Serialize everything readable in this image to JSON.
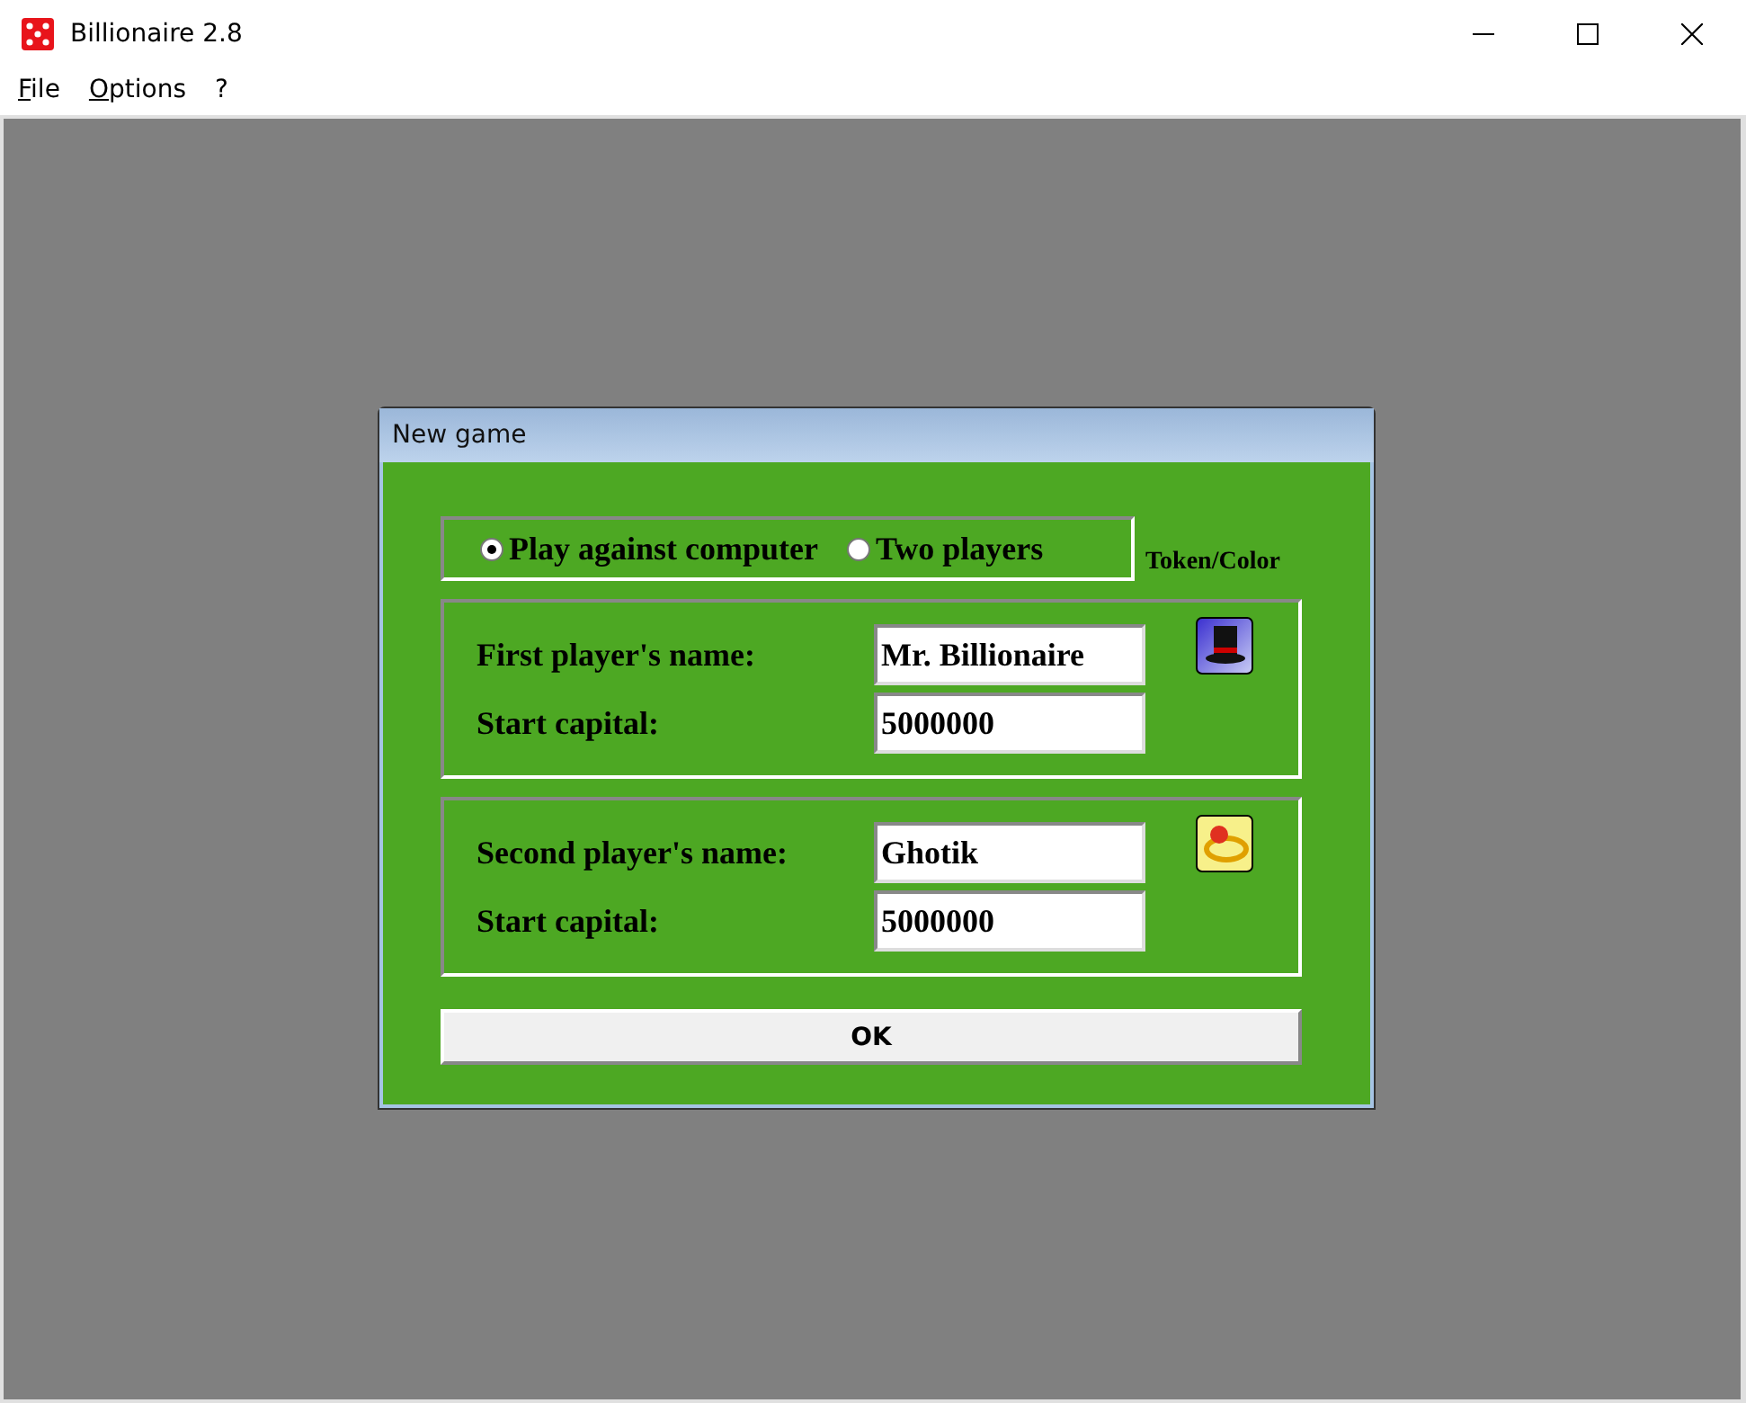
{
  "window": {
    "title": "Billionaire 2.8"
  },
  "menu": [
    {
      "label": "File"
    },
    {
      "label": "Options"
    },
    {
      "label": "?"
    }
  ],
  "dialog": {
    "title": "New game",
    "modes": [
      {
        "label": "Play against computer",
        "selected": true
      },
      {
        "label": "Two players",
        "selected": false
      }
    ],
    "token_heading": "Token/Color",
    "players": [
      {
        "name_label": "First player's name:",
        "name": "Mr. Billionaire",
        "capital_label": "Start capital:",
        "capital": "5000000"
      },
      {
        "name_label": "Second player's name:",
        "name": "Ghotik",
        "capital_label": "Start capital:",
        "capital": "5000000"
      }
    ],
    "ok": "OK"
  }
}
